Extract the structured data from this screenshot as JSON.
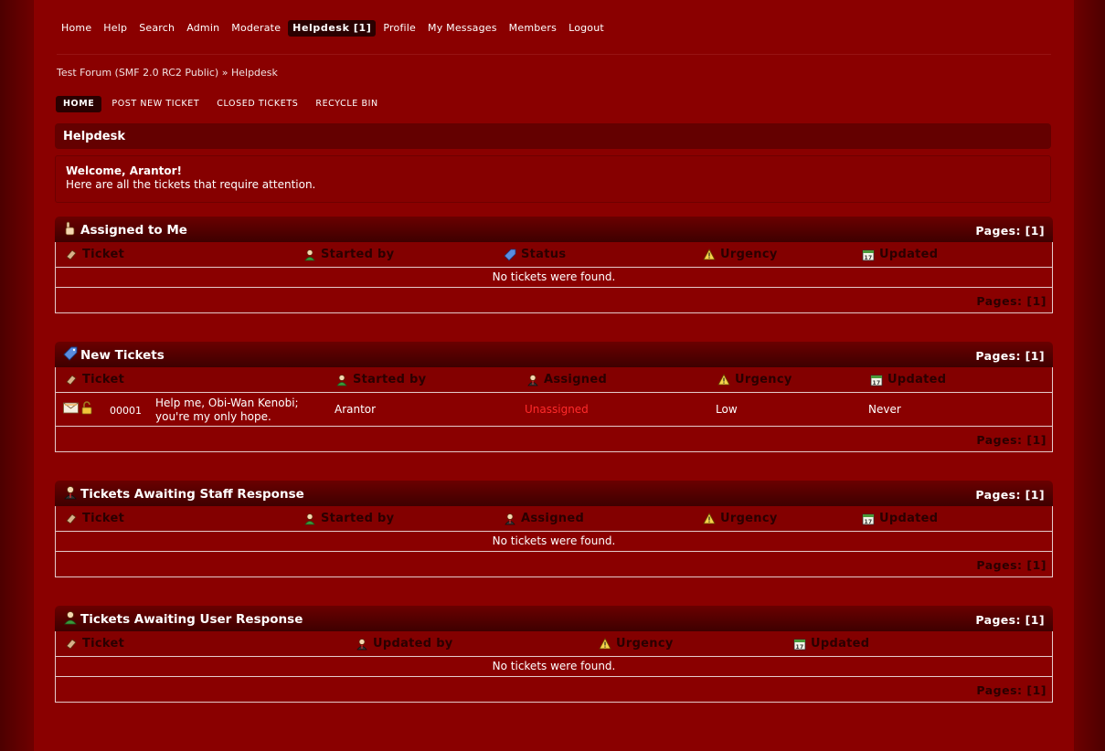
{
  "nav": {
    "items": [
      "Home",
      "Help",
      "Search",
      "Admin",
      "Moderate",
      "Helpdesk [1]",
      "Profile",
      "My Messages",
      "Members",
      "Logout"
    ],
    "active_index": 5
  },
  "breadcrumb": {
    "forum": "Test Forum (SMF 2.0 RC2 Public)",
    "separator": "»",
    "current": "Helpdesk"
  },
  "subtabs": {
    "items": [
      "HOME",
      "POST NEW TICKET",
      "CLOSED TICKETS",
      "RECYCLE BIN"
    ],
    "active_index": 0
  },
  "page_title": "Helpdesk",
  "welcome": {
    "heading": "Welcome, Arantor!",
    "text": "Here are all the tickets that require attention."
  },
  "empty_message": "No tickets were found.",
  "pages_label": "Pages: [1]",
  "sections": {
    "assigned": {
      "title": "Assigned to Me",
      "columns": [
        "Ticket",
        "Started by",
        "Status",
        "Urgency",
        "Updated"
      ]
    },
    "new": {
      "title": "New Tickets",
      "columns": [
        "Ticket",
        "Started by",
        "Assigned",
        "Urgency",
        "Updated"
      ],
      "rows": [
        {
          "id": "00001",
          "subject_line1": "Help me, Obi-Wan Kenobi;",
          "subject_line2": "you're my only hope.",
          "started_by": "Arantor",
          "assigned": "Unassigned",
          "urgency": "Low",
          "updated": "Never"
        }
      ]
    },
    "staff": {
      "title": "Tickets Awaiting Staff Response",
      "columns": [
        "Ticket",
        "Started by",
        "Assigned",
        "Urgency",
        "Updated"
      ]
    },
    "user": {
      "title": "Tickets Awaiting User Response",
      "columns": [
        "Ticket",
        "Updated by",
        "Urgency",
        "Updated"
      ]
    }
  },
  "colors": {
    "background": "#8a0000",
    "header_dark": "#3e0000",
    "unassigned": "#ff2a2a",
    "accent_text": "#2a0000"
  }
}
